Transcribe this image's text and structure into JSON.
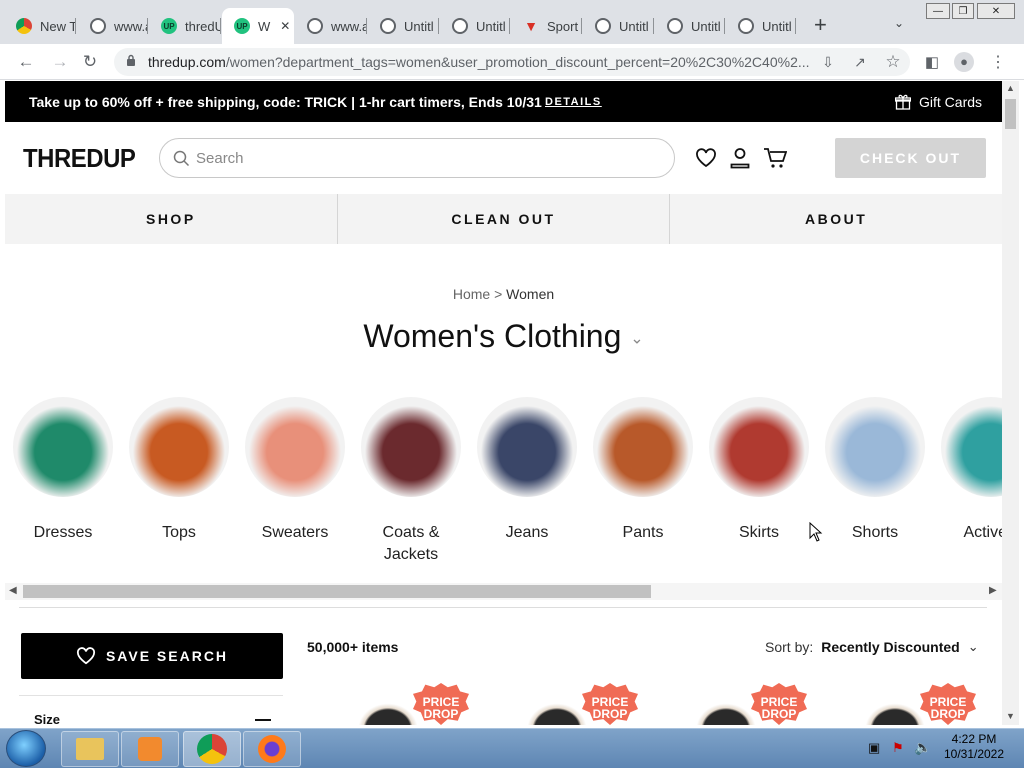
{
  "browser": {
    "tabs": [
      {
        "title": "New T",
        "favicon": "chrome-icon"
      },
      {
        "title": "www.a",
        "favicon": "globe-icon"
      },
      {
        "title": "thredU",
        "favicon": "thredup-icon"
      },
      {
        "title": "W",
        "favicon": "thredup-icon",
        "active": true
      },
      {
        "title": "www.a",
        "favicon": "globe-icon"
      },
      {
        "title": "Untitl",
        "favicon": "globe-icon"
      },
      {
        "title": "Untitl",
        "favicon": "globe-icon"
      },
      {
        "title": "Sport",
        "favicon": "sport-icon"
      },
      {
        "title": "Untitl",
        "favicon": "globe-icon"
      },
      {
        "title": "Untitl",
        "favicon": "globe-icon"
      },
      {
        "title": "Untitl",
        "favicon": "globe-icon"
      }
    ],
    "url_host": "thredup.com",
    "url_path": "/women?department_tags=women&user_promotion_discount_percent=20%2C30%2C40%2..."
  },
  "promo": {
    "text": "Take up to 60% off + free shipping, code: TRICK | 1-hr cart timers, Ends 10/31",
    "details": "DETAILS",
    "gift_cards": "Gift Cards"
  },
  "header": {
    "logo": "THREDUP",
    "search_placeholder": "Search",
    "checkout": "CHECK OUT"
  },
  "nav": {
    "shop": "SHOP",
    "clean_out": "CLEAN OUT",
    "about": "ABOUT"
  },
  "breadcrumb": {
    "home": "Home",
    "sep": ">",
    "current": "Women"
  },
  "heading": "Women's Clothing",
  "categories": [
    {
      "label": "Dresses",
      "color": "#1f8a6a"
    },
    {
      "label": "Tops",
      "color": "#c85a22"
    },
    {
      "label": "Sweaters",
      "color": "#e8907a"
    },
    {
      "label": "Coats & Jackets",
      "color": "#6b2a2e"
    },
    {
      "label": "Jeans",
      "color": "#3a4668"
    },
    {
      "label": "Pants",
      "color": "#b8592a"
    },
    {
      "label": "Skirts",
      "color": "#b03a30"
    },
    {
      "label": "Shorts",
      "color": "#9ab8d8"
    },
    {
      "label": "Activew",
      "color": "#2fa0a0"
    }
  ],
  "results": {
    "save_search": "SAVE SEARCH",
    "count": "50,000+ items",
    "sort_label": "Sort by:",
    "sort_value": "Recently Discounted",
    "size_label": "Size",
    "badge": "PRICE DROP"
  },
  "taskbar": {
    "time": "4:22 PM",
    "date": "10/31/2022"
  }
}
